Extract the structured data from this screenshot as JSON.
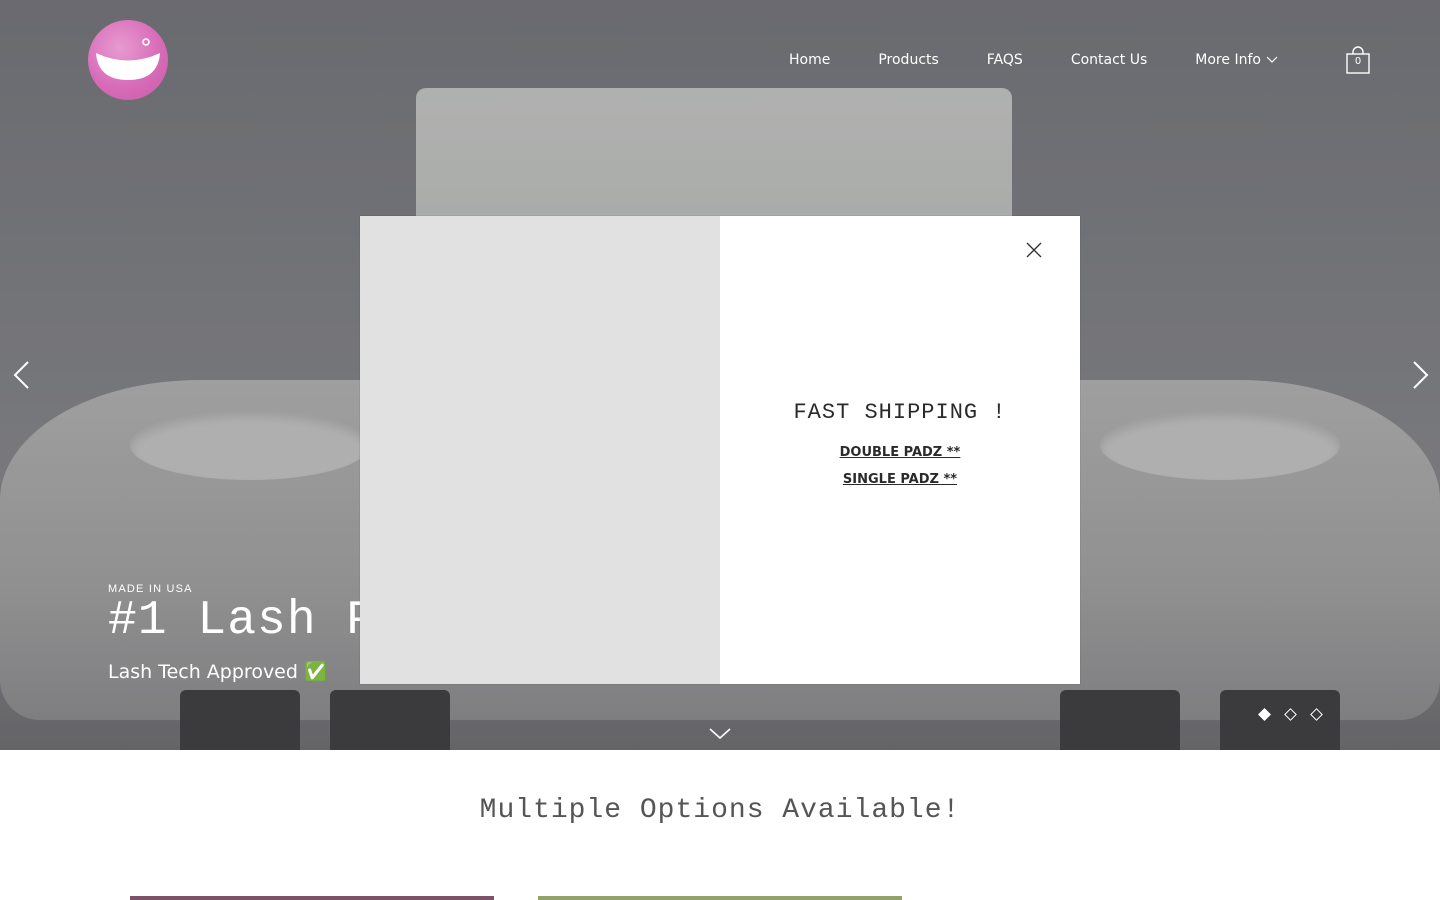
{
  "header": {
    "logo_icon": "smile-logo-icon",
    "nav": [
      {
        "label": "Home"
      },
      {
        "label": "Products"
      },
      {
        "label": "FAQS"
      },
      {
        "label": "Contact Us"
      },
      {
        "label": "More Info",
        "has_dropdown": true
      }
    ],
    "cart_count": "0"
  },
  "hero": {
    "eyebrow": "MADE IN USA",
    "title": "#1 Lash P",
    "subtitle": "Lash Tech Approved ✅",
    "slides_total": 3,
    "active_slide": 1
  },
  "section": {
    "title": "Multiple Options Available!"
  },
  "popup": {
    "heading": "FAST SHIPPING !",
    "links": [
      "DOUBLE PADZ **",
      "SINGLE PADZ **"
    ]
  },
  "colors": {
    "logo": "#d86cb9",
    "popup_image_bg": "#e1e1e2",
    "hero_text": "#ffffff"
  }
}
